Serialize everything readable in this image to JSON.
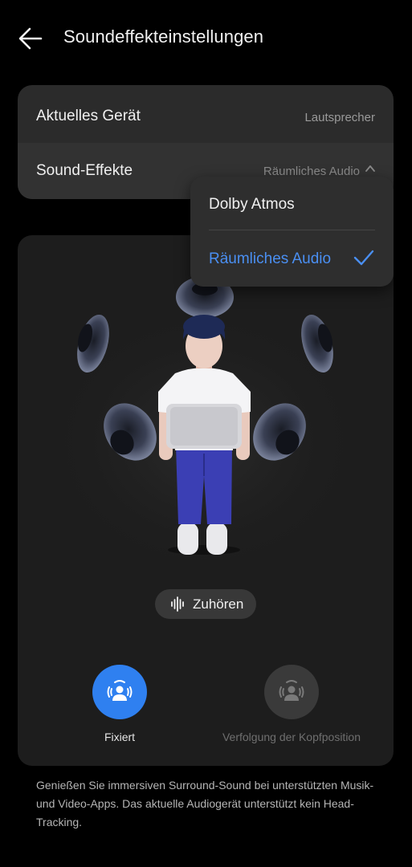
{
  "header": {
    "title": "Soundeffekteinstellungen"
  },
  "settings": {
    "current_device": {
      "label": "Aktuelles Gerät",
      "value": "Lautsprecher"
    },
    "sound_effects": {
      "label": "Sound-Effekte",
      "value": "Räumliches Audio"
    }
  },
  "dropdown": {
    "options": [
      {
        "label": "Dolby Atmos",
        "selected": false
      },
      {
        "label": "Räumliches Audio",
        "selected": true
      }
    ]
  },
  "preview": {
    "listen_label": "Zuhören"
  },
  "modes": [
    {
      "label": "Fixiert",
      "active": true
    },
    {
      "label": "Verfolgung der Kopfposition",
      "active": false
    }
  ],
  "footer": {
    "text": "Genießen Sie immersiven Surround-Sound bei unterstützten Musik- und Video-Apps. Das aktuelle Audiogerät unterstützt kein Head-Tracking."
  },
  "colors": {
    "accent": "#2f80f0",
    "selected_text": "#4a8ff2",
    "background": "#000000",
    "card": "#1d1d1d"
  }
}
